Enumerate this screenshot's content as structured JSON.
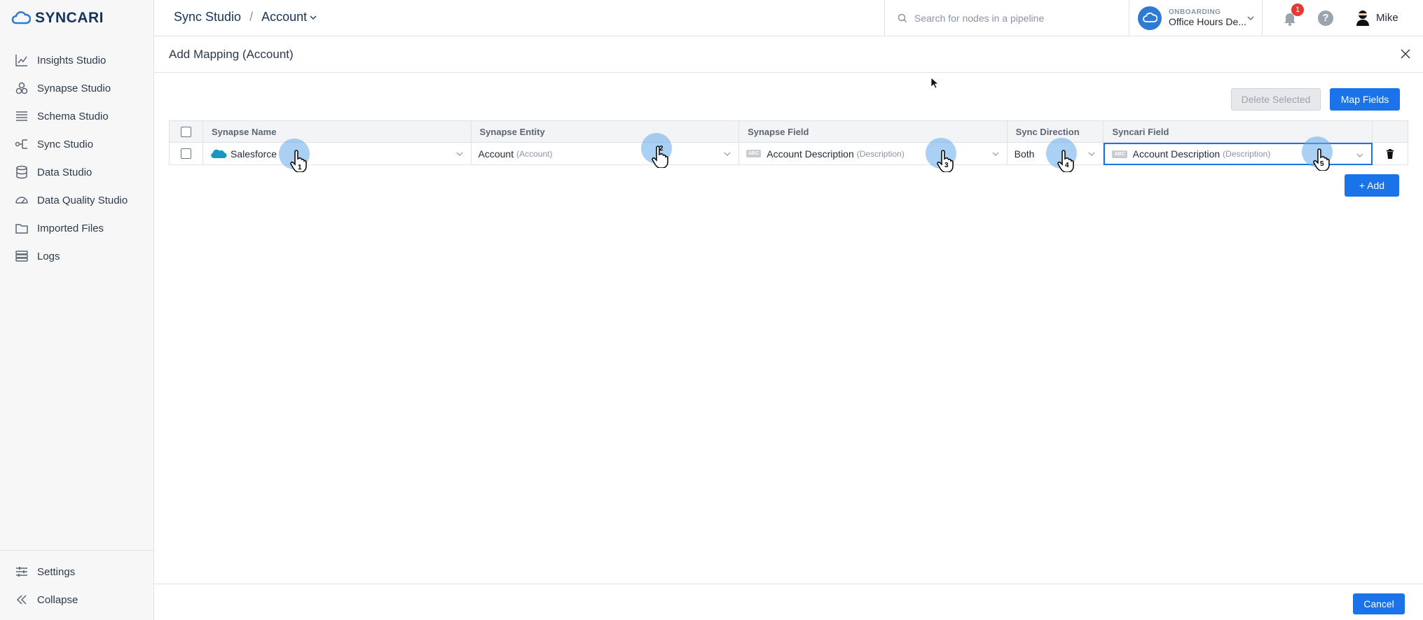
{
  "brand": {
    "logo_text": "SYNCARI",
    "primary_color": "#1a73e8",
    "logo_color": "#2f7bd4"
  },
  "sidebar": {
    "items": [
      {
        "label": "Insights Studio",
        "icon": "chart-icon"
      },
      {
        "label": "Synapse Studio",
        "icon": "synapse-icon"
      },
      {
        "label": "Schema Studio",
        "icon": "list-icon"
      },
      {
        "label": "Sync Studio",
        "icon": "sync-icon"
      },
      {
        "label": "Data Studio",
        "icon": "database-icon"
      },
      {
        "label": "Data Quality Studio",
        "icon": "gauge-icon"
      },
      {
        "label": "Imported Files",
        "icon": "folder-icon"
      },
      {
        "label": "Logs",
        "icon": "logs-icon"
      }
    ],
    "bottom": [
      {
        "label": "Settings",
        "icon": "sliders-icon"
      },
      {
        "label": "Collapse",
        "icon": "double-chevron-left-icon"
      }
    ]
  },
  "header": {
    "breadcrumb_root": "Sync Studio",
    "breadcrumb_sep": "/",
    "breadcrumb_current": "Account",
    "search_placeholder": "Search for nodes in a pipeline",
    "workspace_label": "ONBOARDING",
    "workspace_name": "Office Hours De...",
    "notification_count": "1",
    "help_label": "?",
    "user_name": "Mike"
  },
  "modal": {
    "title": "Add Mapping (Account)",
    "delete_label": "Delete Selected",
    "map_fields_label": "Map Fields",
    "add_label": "+ Add",
    "cancel_label": "Cancel"
  },
  "table": {
    "columns": [
      "Synapse Name",
      "Synapse Entity",
      "Synapse Field",
      "Sync Direction",
      "Syncari Field"
    ],
    "row": {
      "synapse_name": "Salesforce",
      "entity": "Account",
      "entity_sub": "(Account)",
      "field_type": "ABC",
      "field": "Account Description",
      "field_sub": "(Description)",
      "direction": "Both",
      "syncari_field_type": "ABC",
      "syncari_field": "Account Description",
      "syncari_field_sub": "(Description)"
    }
  },
  "click_markers": [
    "1",
    "2",
    "3",
    "4",
    "5"
  ]
}
